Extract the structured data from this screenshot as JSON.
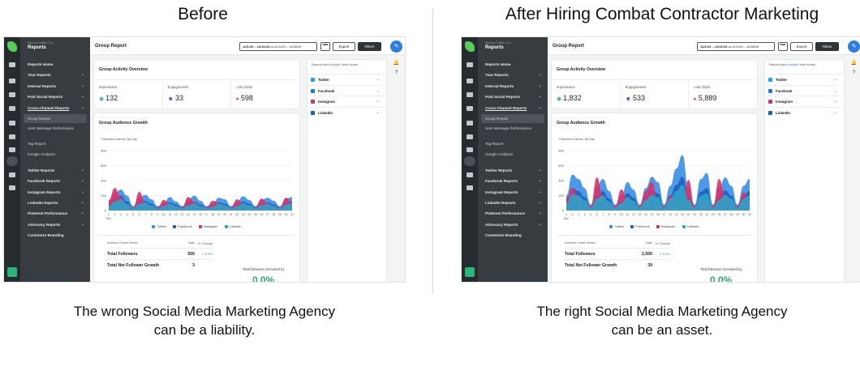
{
  "panels": [
    {
      "heading": "Before",
      "caption_line1": "The wrong Social Media Marketing Agency",
      "caption_line2": "can be a liability.",
      "app": {
        "company": "Sprout Coffee Co.",
        "section": "Reports",
        "page_title": "Group Report",
        "date_range": "12/1/19 – 12/31/19",
        "date_compare": "vs 11/1/19 – 11/30/19",
        "more": "•••",
        "export": "Export",
        "filters": "Filters",
        "overview_title": "Group Activity Overview",
        "metrics": [
          {
            "label": "Impressions",
            "value": "132",
            "icon": "eye-icon",
            "symbol": "◉",
            "color": "#2fa5a0"
          },
          {
            "label": "Engagements",
            "value": "33",
            "icon": "engagement-icon",
            "symbol": "☻",
            "color": "#5b4ec9"
          },
          {
            "label": "Link Clicks",
            "value": "598",
            "icon": "cursor-icon",
            "symbol": "▸",
            "color": "#d63a4a"
          }
        ],
        "growth_title": "Group Audience Growth",
        "growth_sub": "Followers Gained, By Day",
        "table_headers": [
          "Audience Growth Metrics",
          "Totals",
          "% Change"
        ],
        "table_rows": [
          {
            "label": "Total Followers",
            "value": "500",
            "change": "↗ 5.6%"
          },
          {
            "label": "Total Net Follower Growth",
            "value": "3",
            "change": ""
          }
        ],
        "total_label": "Total followers increased by",
        "total_big": "0.0%",
        "tz_note_pre": "Report uses",
        "tz_note_link": "multiple",
        "tz_note_post": "time zones",
        "networks": [
          {
            "name": "Twitter",
            "color": "#1da1f2"
          },
          {
            "name": "Facebook",
            "color": "#1877f2"
          },
          {
            "name": "Instagram",
            "color": "#d6336c"
          },
          {
            "name": "LinkedIn",
            "color": "#0a66c2"
          }
        ]
      },
      "chart_data": {
        "type": "area",
        "title": "Group Audience Growth",
        "subtitle": "Followers Gained, By Day",
        "ylim": [
          0,
          800
        ],
        "yticks": [
          0,
          200,
          400,
          600,
          800
        ],
        "categories": [
          "1",
          "2",
          "3",
          "4",
          "5",
          "6",
          "7",
          "8",
          "9",
          "10",
          "11",
          "12",
          "13",
          "14",
          "15",
          "16",
          "17",
          "18",
          "19",
          "20",
          "21",
          "22",
          "23",
          "24",
          "25",
          "26",
          "27",
          "28",
          "29",
          "30",
          "31"
        ],
        "x_sub_label": "Dec",
        "series": [
          {
            "name": "Twitter",
            "color": "#3a8ee6",
            "values": [
              120,
              230,
              280,
              200,
              60,
              170,
              210,
              150,
              60,
              100,
              180,
              120,
              60,
              140,
              200,
              130,
              60,
              90,
              170,
              150,
              60,
              120,
              190,
              140,
              60,
              140,
              170,
              130,
              60,
              160,
              180
            ]
          },
          {
            "name": "Facebook",
            "color": "#1f5fbf",
            "values": [
              80,
              150,
              200,
              120,
              40,
              110,
              130,
              90,
              40,
              70,
              110,
              80,
              40,
              90,
              120,
              80,
              40,
              60,
              110,
              90,
              40,
              80,
              120,
              90,
              40,
              90,
              110,
              80,
              40,
              100,
              120
            ]
          },
          {
            "name": "Instagram",
            "color": "#d6336c",
            "values": [
              140,
              300,
              180,
              80,
              40,
              250,
              110,
              60,
              40,
              140,
              90,
              60,
              40,
              180,
              120,
              60,
              40,
              130,
              100,
              60,
              40,
              150,
              90,
              60,
              40,
              160,
              100,
              60,
              40,
              170,
              110
            ]
          },
          {
            "name": "LinkedIn",
            "color": "#2aa4c9",
            "values": [
              60,
              120,
              150,
              90,
              30,
              90,
              110,
              70,
              30,
              60,
              90,
              60,
              30,
              70,
              100,
              60,
              30,
              50,
              90,
              70,
              30,
              60,
              100,
              70,
              30,
              70,
              90,
              60,
              30,
              80,
              100
            ]
          }
        ]
      }
    },
    {
      "heading": "After Hiring Combat Contractor Marketing",
      "caption_line1": "The right Social Media Marketing Agency",
      "caption_line2": "can be an asset.",
      "app": {
        "company": "Sprout Coffee Co.",
        "section": "Reports",
        "page_title": "Group Report",
        "date_range": "12/1/19 – 12/31/19",
        "date_compare": "vs 11/1/19 – 11/30/19",
        "more": "•••",
        "export": "Export",
        "filters": "Filters",
        "overview_title": "Group Activity Overview",
        "metrics": [
          {
            "label": "Impressions",
            "value": "1,832",
            "icon": "eye-icon",
            "symbol": "◉",
            "color": "#2fa5a0"
          },
          {
            "label": "Engagements",
            "value": "533",
            "icon": "engagement-icon",
            "symbol": "☻",
            "color": "#5b4ec9"
          },
          {
            "label": "Link Clicks",
            "value": "5,889",
            "icon": "cursor-icon",
            "symbol": "▸",
            "color": "#d63a4a"
          }
        ],
        "growth_title": "Group Audience Growth",
        "growth_sub": "Followers Gained, By Day",
        "table_headers": [
          "Audience Growth Metrics",
          "Totals",
          "% Change"
        ],
        "table_rows": [
          {
            "label": "Total Followers",
            "value": "2,500",
            "change": "↗ 5.6%"
          },
          {
            "label": "Total Net Follower Growth",
            "value": "39",
            "change": ""
          }
        ],
        "total_label": "Total followers increased by",
        "total_big": "0.0%",
        "tz_note_pre": "Report uses",
        "tz_note_link": "multiple",
        "tz_note_post": "time zones",
        "networks": [
          {
            "name": "Twitter",
            "color": "#1da1f2"
          },
          {
            "name": "Facebook",
            "color": "#1877f2"
          },
          {
            "name": "Instagram",
            "color": "#d6336c"
          },
          {
            "name": "LinkedIn",
            "color": "#0a66c2"
          }
        ]
      },
      "chart_data": {
        "type": "area",
        "title": "Group Audience Growth",
        "subtitle": "Followers Gained, By Day",
        "ylim": [
          0,
          800
        ],
        "yticks": [
          0,
          200,
          400,
          600,
          800
        ],
        "categories": [
          "1",
          "2",
          "3",
          "4",
          "5",
          "6",
          "7",
          "8",
          "9",
          "10",
          "11",
          "12",
          "13",
          "14",
          "15",
          "16",
          "17",
          "18",
          "19",
          "20",
          "21",
          "22",
          "23",
          "24",
          "25",
          "26",
          "27",
          "28",
          "29",
          "30",
          "31"
        ],
        "x_sub_label": "Dec",
        "series": [
          {
            "name": "Twitter",
            "color": "#3a8ee6",
            "values": [
              200,
              480,
              420,
              300,
              80,
              330,
              420,
              260,
              80,
              200,
              380,
              280,
              80,
              300,
              450,
              380,
              80,
              330,
              560,
              740,
              300,
              80,
              420,
              500,
              80,
              300,
              440,
              330,
              80,
              330,
              420
            ]
          },
          {
            "name": "Facebook",
            "color": "#1f5fbf",
            "values": [
              120,
              300,
              260,
              180,
              50,
              200,
              260,
              160,
              50,
              120,
              230,
              170,
              50,
              180,
              270,
              230,
              50,
              200,
              340,
              450,
              180,
              50,
              250,
              300,
              50,
              180,
              270,
              200,
              50,
              200,
              260
            ]
          },
          {
            "name": "Instagram",
            "color": "#d6336c",
            "values": [
              160,
              300,
              200,
              120,
              60,
              440,
              200,
              100,
              60,
              280,
              160,
              100,
              60,
              260,
              380,
              120,
              60,
              200,
              160,
              160,
              410,
              60,
              160,
              140,
              60,
              420,
              200,
              120,
              60,
              240,
              160
            ]
          },
          {
            "name": "LinkedIn",
            "color": "#2aa4c9",
            "values": [
              100,
              220,
              200,
              140,
              40,
              160,
              200,
              120,
              40,
              100,
              180,
              130,
              40,
              140,
              210,
              180,
              40,
              160,
              260,
              340,
              140,
              40,
              200,
              230,
              40,
              140,
              210,
              160,
              40,
              160,
              200
            ]
          }
        ]
      }
    }
  ],
  "nav": {
    "items": [
      {
        "label": "Reports Home",
        "chev": false,
        "kind": "top"
      },
      {
        "label": "Your Reports",
        "chev": true,
        "kind": "top"
      },
      {
        "label": "Internal Reports",
        "chev": true,
        "kind": "top"
      },
      {
        "label": "Paid Social Reports",
        "chev": true,
        "kind": "top"
      },
      {
        "label": "Cross-Channel Reports",
        "chev": true,
        "kind": "underline"
      },
      {
        "label": "Group Report",
        "chev": false,
        "kind": "selected"
      },
      {
        "label": "Sent Message Performance",
        "chev": false,
        "kind": "two"
      },
      {
        "label": "Tag Report",
        "chev": false,
        "kind": "sub"
      },
      {
        "label": "Google Analytics",
        "chev": false,
        "kind": "sub"
      },
      {
        "label": "Twitter Reports",
        "chev": true,
        "kind": "gap"
      },
      {
        "label": "Facebook Reports",
        "chev": true,
        "kind": "top"
      },
      {
        "label": "Instagram Reports",
        "chev": true,
        "kind": "top"
      },
      {
        "label": "LinkedIn Reports",
        "chev": true,
        "kind": "top"
      },
      {
        "label": "Pinterest Performance",
        "chev": true,
        "kind": "top"
      },
      {
        "label": "Advocacy Reports",
        "chev": true,
        "kind": "top"
      },
      {
        "label": "Customize Branding",
        "chev": false,
        "kind": "top"
      }
    ],
    "chev_symbol": "⌄"
  },
  "rail_icons": [
    "inbox-icon",
    "profile-icon",
    "tasks-icon",
    "pin-icon",
    "list-icon",
    "send-icon",
    "listening-icon",
    "reports-icon",
    "bot-icon",
    "star-icon"
  ],
  "side_icons": [
    {
      "name": "bell-icon",
      "symbol": "🔔"
    },
    {
      "name": "help-icon",
      "symbol": "?"
    }
  ],
  "compose_symbol": "✎",
  "chev_symbol": "⌄"
}
